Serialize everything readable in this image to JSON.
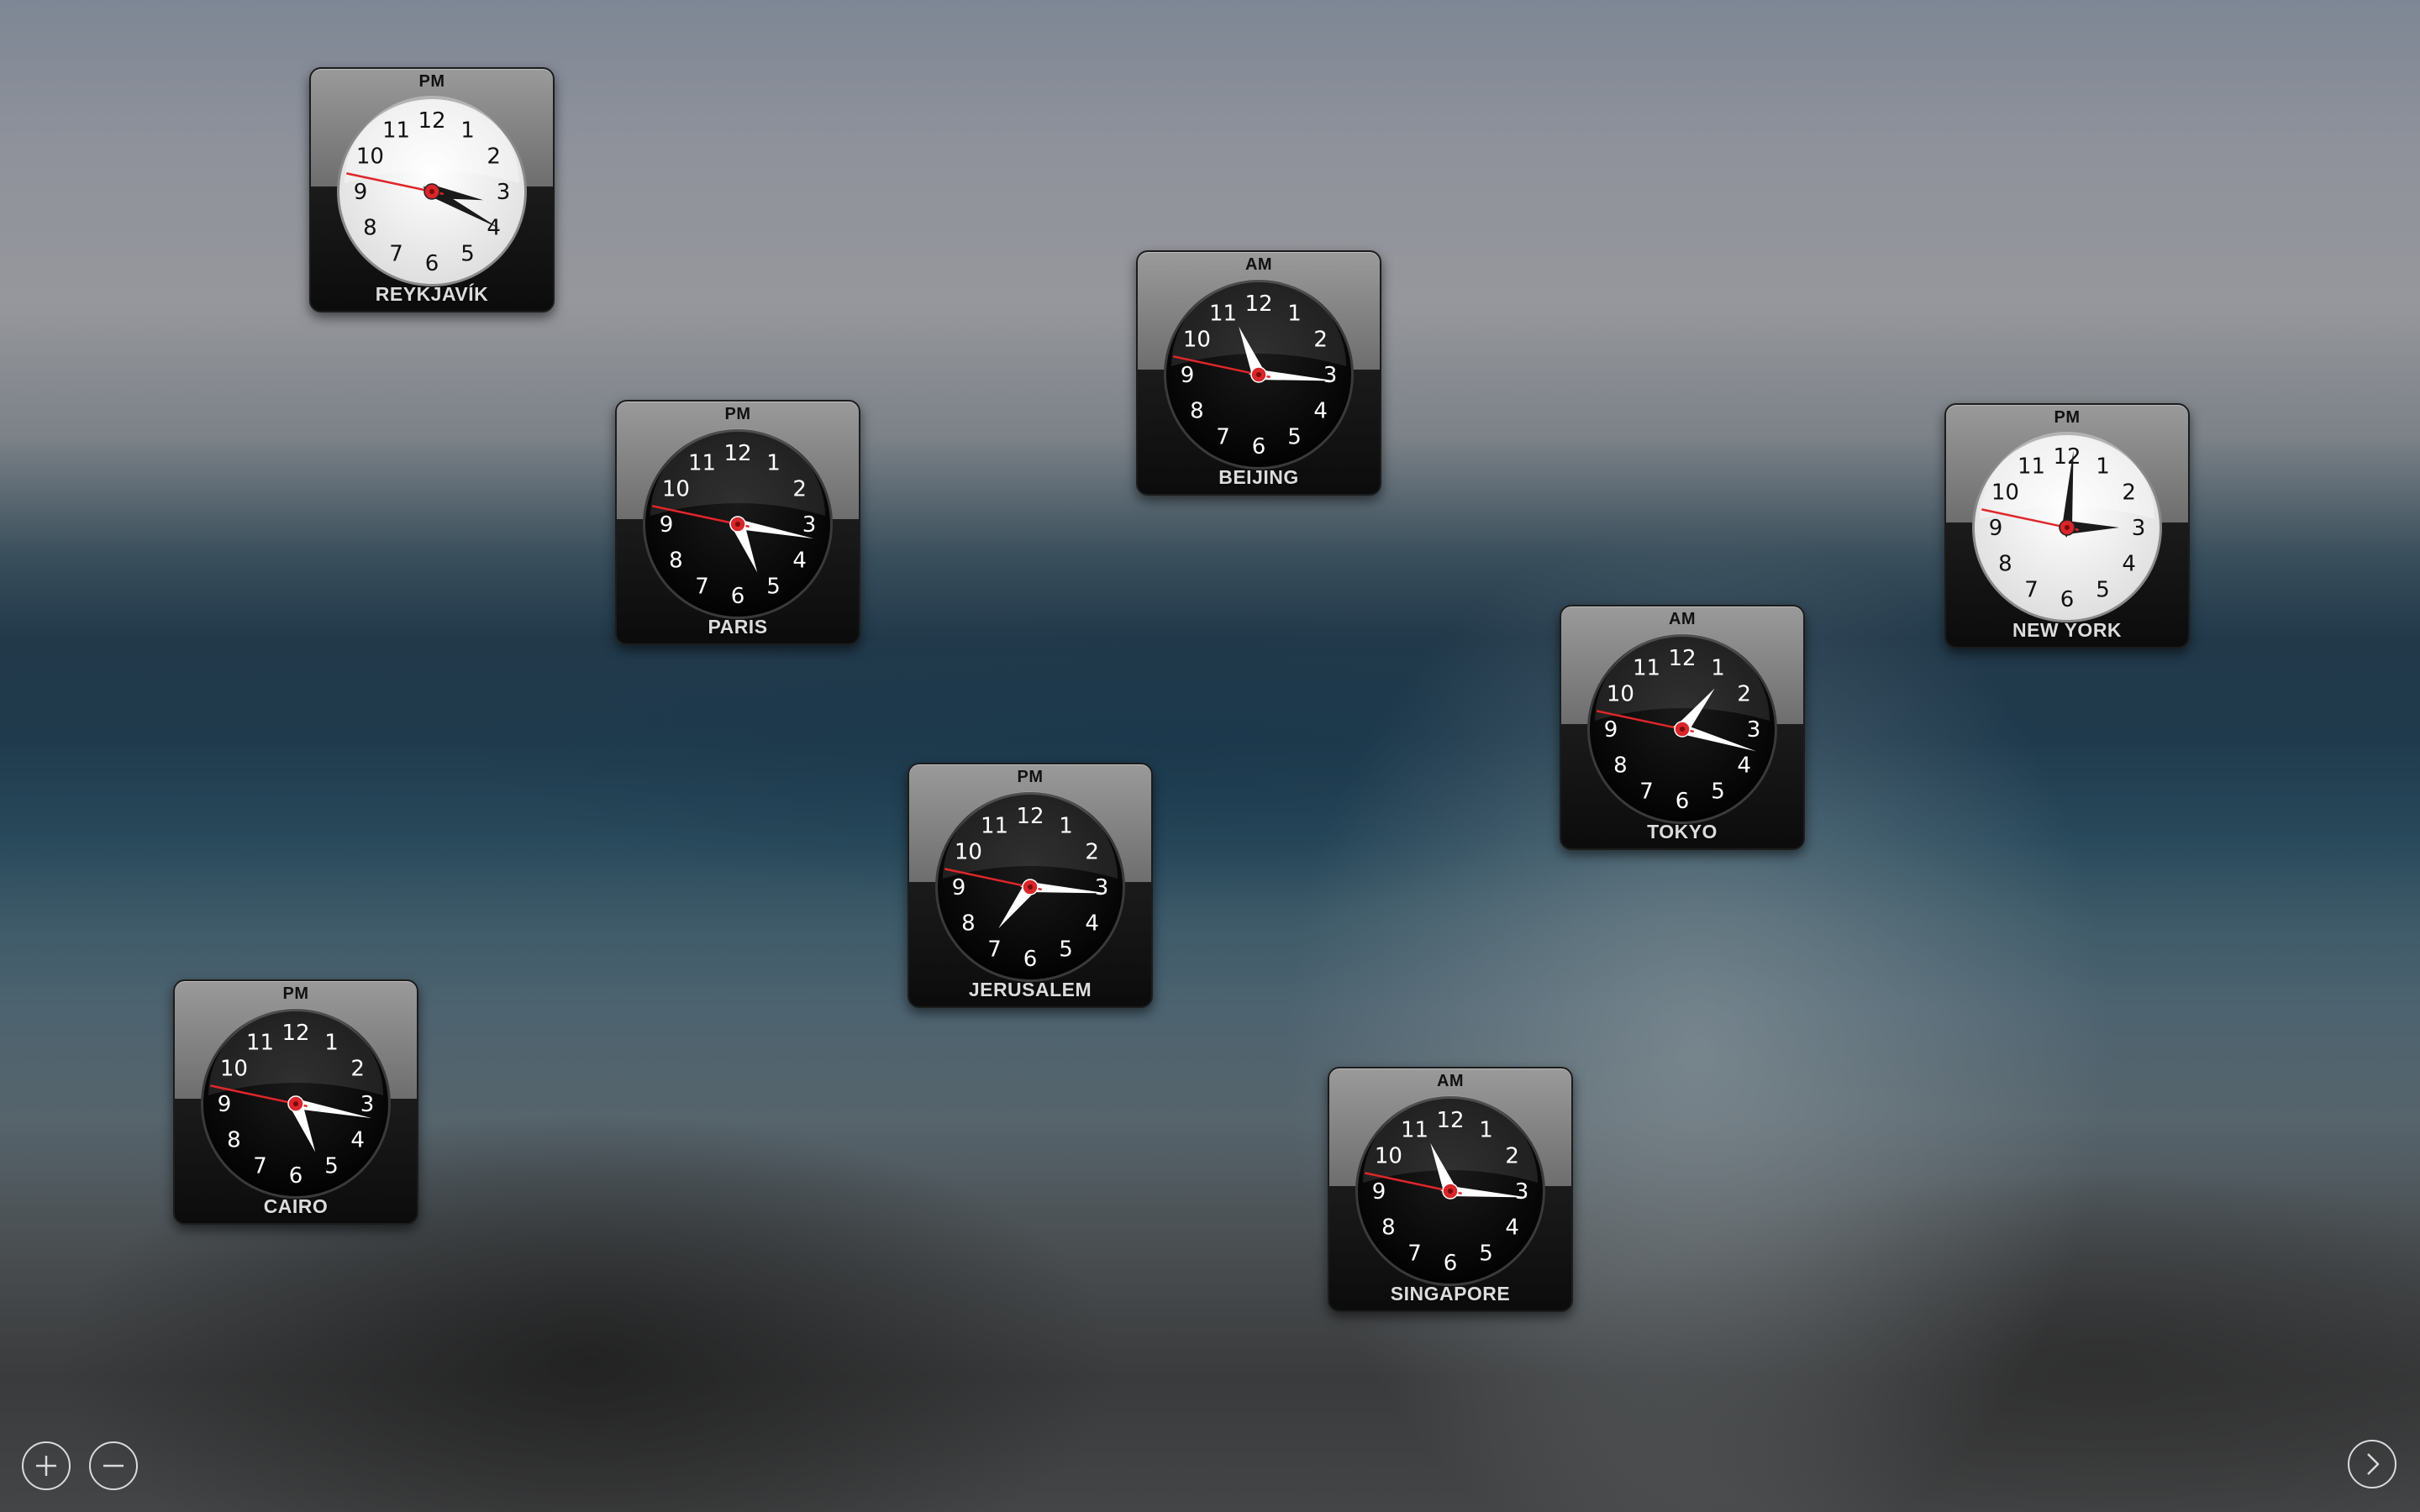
{
  "clocks": [
    {
      "id": "reykjavik",
      "city": "REYKJAVÍK",
      "period": "PM",
      "theme": "light",
      "time": {
        "hours": 3,
        "minutes": 19,
        "seconds": 47
      }
    },
    {
      "id": "beijing",
      "city": "BEIJING",
      "period": "AM",
      "theme": "dark",
      "time": {
        "hours": 11,
        "minutes": 15,
        "seconds": 47
      }
    },
    {
      "id": "paris",
      "city": "PARIS",
      "period": "PM",
      "theme": "dark",
      "time": {
        "hours": 5,
        "minutes": 16,
        "seconds": 47
      }
    },
    {
      "id": "new-york",
      "city": "NEW YORK",
      "period": "PM",
      "theme": "light",
      "time": {
        "hours": 3,
        "minutes": 0,
        "seconds": 47
      }
    },
    {
      "id": "tokyo",
      "city": "TOKYO",
      "period": "AM",
      "theme": "dark",
      "time": {
        "hours": 1,
        "minutes": 17,
        "seconds": 47
      }
    },
    {
      "id": "jerusalem",
      "city": "JERUSALEM",
      "period": "PM",
      "theme": "dark",
      "time": {
        "hours": 7,
        "minutes": 15,
        "seconds": 47
      }
    },
    {
      "id": "cairo",
      "city": "CAIRO",
      "period": "PM",
      "theme": "dark",
      "time": {
        "hours": 5,
        "minutes": 16,
        "seconds": 47
      }
    },
    {
      "id": "singapore",
      "city": "SINGAPORE",
      "period": "AM",
      "theme": "dark",
      "time": {
        "hours": 11,
        "minutes": 15,
        "seconds": 47
      }
    }
  ],
  "dial_numbers": [
    "12",
    "1",
    "2",
    "3",
    "4",
    "5",
    "6",
    "7",
    "8",
    "9",
    "10",
    "11"
  ],
  "controls": {
    "add_icon": "plus-circle-icon",
    "remove_icon": "minus-circle-icon",
    "next_icon": "chevron-right-circle-icon"
  },
  "colors": {
    "second_hand": "#e0262b",
    "center_dot": "#d8262b",
    "light_face": "#f4f4f4",
    "dark_face": "#0a0a0a"
  }
}
